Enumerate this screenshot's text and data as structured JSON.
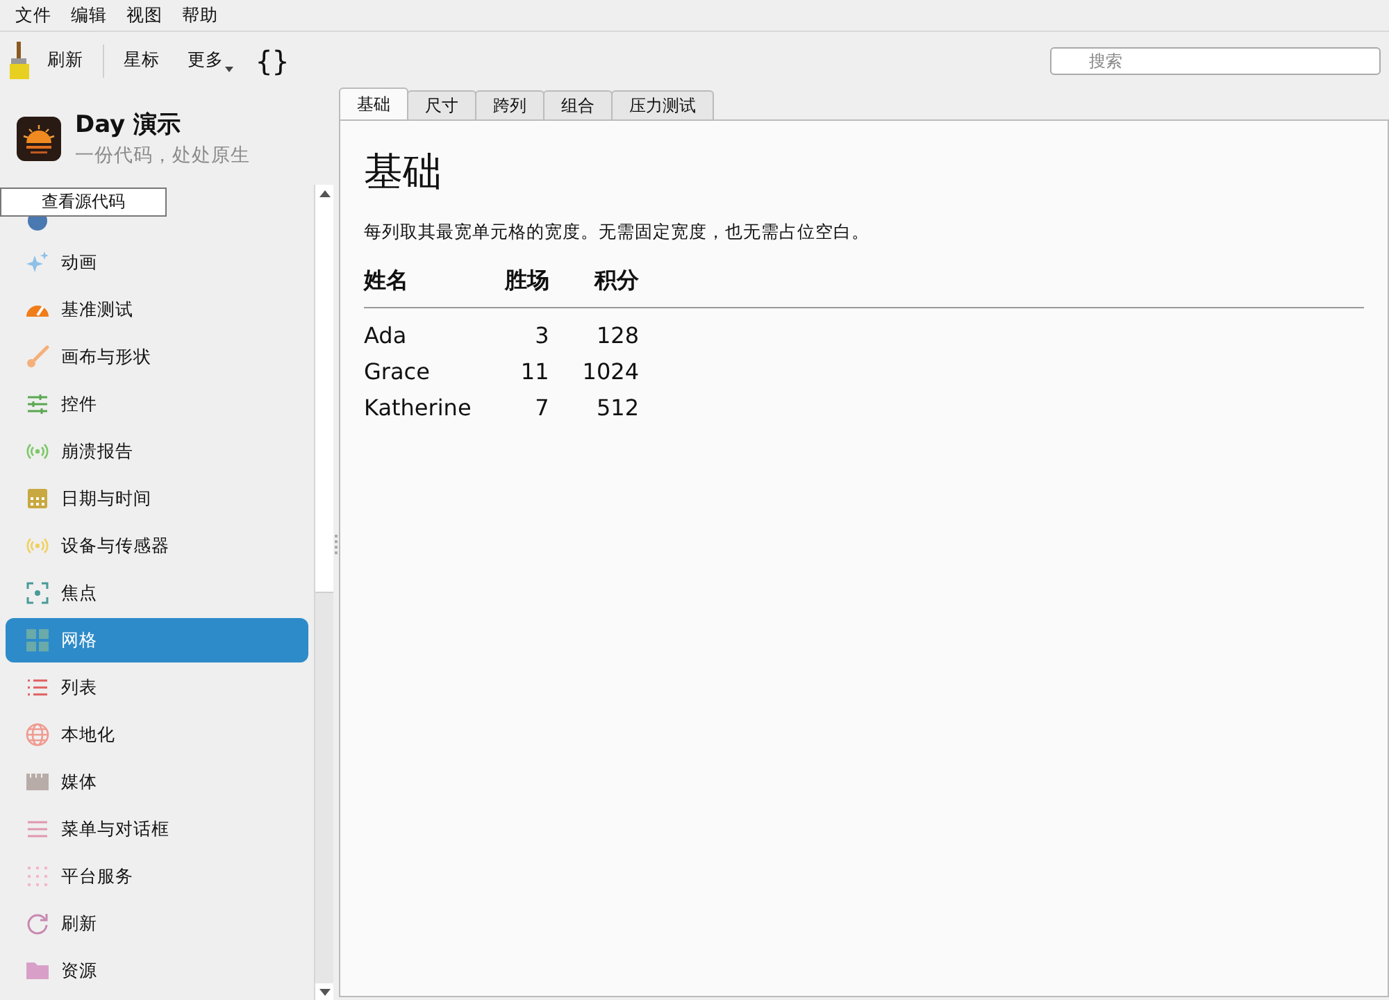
{
  "menu_bar": [
    "文件",
    "编辑",
    "视图",
    "帮助"
  ],
  "toolbar": {
    "buttons": [
      {
        "label": "刷新",
        "kind": "text"
      },
      {
        "label": "星标",
        "kind": "text"
      },
      {
        "label": "更多",
        "kind": "dropdown"
      },
      {
        "label": "{}",
        "kind": "braces"
      }
    ],
    "search": {
      "placeholder": "搜索"
    }
  },
  "app": {
    "title": "Day 演示",
    "subtitle": "一份代码，处处原生"
  },
  "tooltip": "查看源代码",
  "sidebar": {
    "items": [
      {
        "kind": "circle",
        "color": "#4a78b0",
        "selected": false
      },
      {
        "label": "动画",
        "kind": "sparkle",
        "color": "#8ec0e8",
        "selected": false
      },
      {
        "label": "基准测试",
        "kind": "gauge",
        "color": "#f07c1a",
        "selected": false
      },
      {
        "label": "画布与形状",
        "kind": "brush",
        "color": "#f5b07a",
        "selected": false
      },
      {
        "label": "控件",
        "kind": "sliders",
        "color": "#5aa850",
        "selected": false
      },
      {
        "label": "崩溃报告",
        "kind": "broadcast",
        "color": "#7cc868",
        "selected": false
      },
      {
        "label": "日期与时间",
        "kind": "calendar",
        "color": "#c8a840",
        "selected": false
      },
      {
        "label": "设备与传感器",
        "kind": "broadcast",
        "color": "#f0d060",
        "selected": false
      },
      {
        "label": "焦点",
        "kind": "focus",
        "color": "#4a9a98",
        "selected": false
      },
      {
        "label": "网格",
        "kind": "grid",
        "color": "#6aaaa8",
        "selected": true
      },
      {
        "label": "列表",
        "kind": "list",
        "color": "#e06060",
        "selected": false
      },
      {
        "label": "本地化",
        "kind": "globe",
        "color": "#f09a90",
        "selected": false
      },
      {
        "label": "媒体",
        "kind": "clapper",
        "color": "#b8aca8",
        "selected": false
      },
      {
        "label": "菜单与对话框",
        "kind": "menu",
        "color": "#e098b0",
        "selected": false
      },
      {
        "label": "平台服务",
        "kind": "dots",
        "color": "#f4b8c8",
        "selected": false
      },
      {
        "label": "刷新",
        "kind": "refresh",
        "color": "#c888b0",
        "selected": false
      },
      {
        "label": "资源",
        "kind": "folder",
        "color": "#d8a0c8",
        "selected": false
      }
    ]
  },
  "tabs": [
    {
      "label": "基础",
      "selected": true
    },
    {
      "label": "尺寸",
      "selected": false
    },
    {
      "label": "跨列",
      "selected": false
    },
    {
      "label": "组合",
      "selected": false
    },
    {
      "label": "压力测试",
      "selected": false
    }
  ],
  "content": {
    "heading": "基础",
    "description": "每列取其最宽单元格的宽度。无需固定宽度，也无需占位空白。",
    "table": {
      "columns": [
        "姓名",
        "胜场",
        "积分"
      ],
      "rows": [
        [
          "Ada",
          "3",
          "128"
        ],
        [
          "Grace",
          "11",
          "1024"
        ],
        [
          "Katherine",
          "7",
          "512"
        ]
      ]
    }
  }
}
